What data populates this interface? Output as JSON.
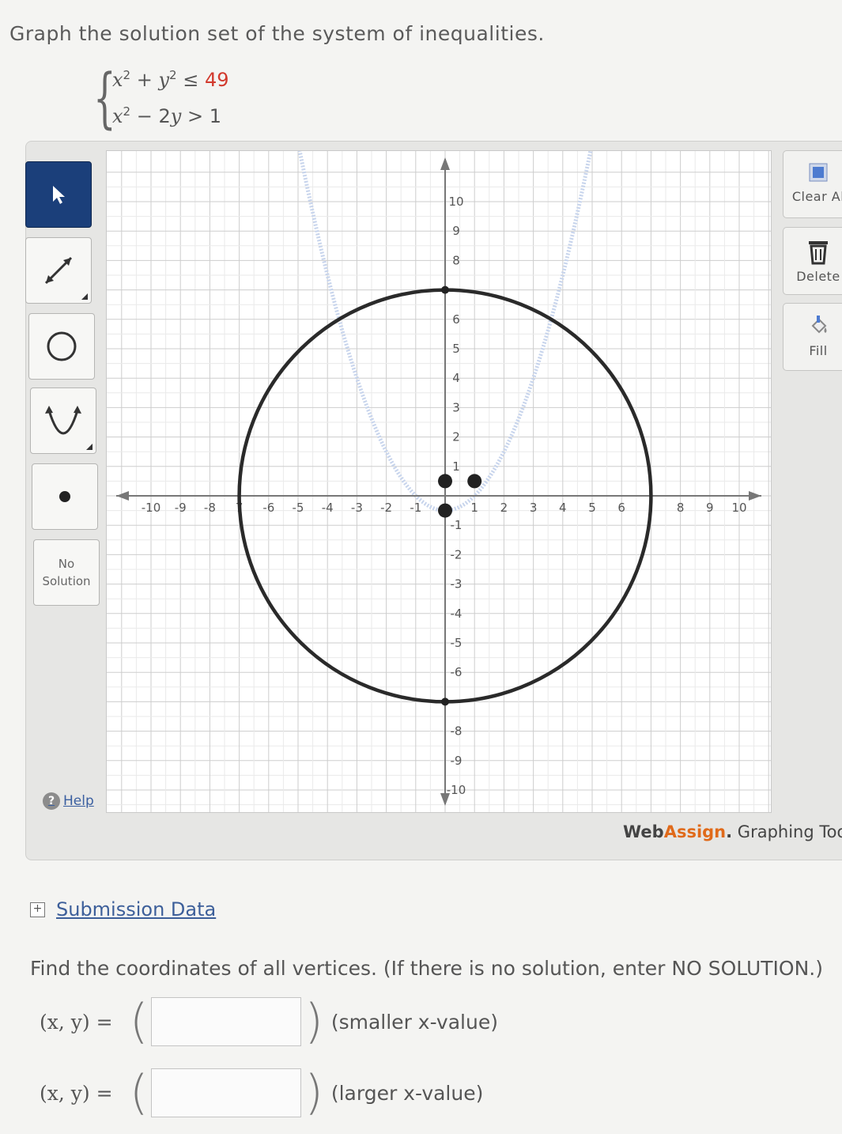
{
  "question": "Graph the solution set of the system of inequalities.",
  "system": {
    "ineq1": {
      "lhs_a": "x",
      "lhs_b": "y",
      "sign": "≤",
      "rhs": "49",
      "op": "+"
    },
    "ineq2": {
      "lhs_a": "x",
      "lhs_b": "2y",
      "sign": ">",
      "rhs": "1",
      "op": "−"
    }
  },
  "toolbar": {
    "tools": [
      {
        "name": "pointer",
        "icon": "arrow-pointer-icon",
        "active": true
      },
      {
        "name": "line",
        "icon": "line-tool-icon",
        "active": false
      },
      {
        "name": "circle",
        "icon": "circle-tool-icon",
        "active": false
      },
      {
        "name": "parabola",
        "icon": "parabola-tool-icon",
        "active": false
      },
      {
        "name": "point",
        "icon": "point-tool-icon",
        "active": false
      }
    ],
    "no_solution_line1": "No",
    "no_solution_line2": "Solution",
    "help_label": "Help",
    "clear_all_label": "Clear Al",
    "delete_label": "Delete",
    "fill_label": "Fill"
  },
  "graph": {
    "x_range": [
      -10,
      10
    ],
    "y_range": [
      -10,
      10
    ],
    "x_tick_labels": [
      "-10",
      "-9",
      "-8",
      "7",
      "-6",
      "-5",
      "-4",
      "-3",
      "-2",
      "-1",
      "1",
      "2",
      "3",
      "4",
      "5",
      "6",
      "8",
      "9",
      "10"
    ],
    "y_tick_labels": [
      "10",
      "9",
      "8",
      "6",
      "5",
      "4",
      "3",
      "2",
      "1",
      "-1",
      "-2",
      "-3",
      "-4",
      "-5",
      "-6",
      "-8",
      "-9",
      "-10"
    ],
    "circle": {
      "center": [
        0,
        0
      ],
      "radius": 7,
      "color": "#2a2a2a"
    },
    "parabola": {
      "equation": "x^2 - 2y = 1",
      "vertex": [
        0,
        -0.5
      ],
      "color": "#c7d4ec"
    },
    "points": [
      [
        0,
        0.5
      ],
      [
        0,
        -0.5
      ],
      [
        1,
        0.5
      ]
    ]
  },
  "brand": {
    "part1": "Web",
    "part2": "Assign",
    "part3": ".",
    "part4": " Graphing Too"
  },
  "submission_label": "Submission Data",
  "find_text": "Find the coordinates of all vertices. (If there is no solution, enter NO SOLUTION.)",
  "answers": [
    {
      "label": "(x, y) =",
      "value": "",
      "note": "(smaller x-value)"
    },
    {
      "label": "(x, y) =",
      "value": "",
      "note": "(larger x-value)"
    }
  ]
}
